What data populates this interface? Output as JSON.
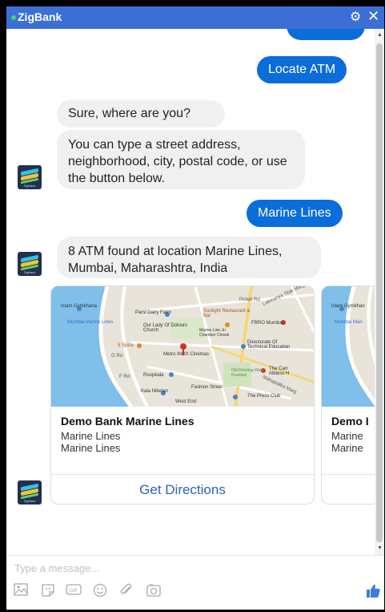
{
  "window": {
    "title": "ZigBank"
  },
  "messages": {
    "locate_atm": "Locate ATM",
    "where_are_you": "Sure, where are you?",
    "type_address": "You can type a street address, neighborhood, city, postal code, or use the button below.",
    "marine_lines": "Marine Lines",
    "atm_found": "8 ATM found at location Marine Lines, Mumbai, Maharashtra, India"
  },
  "avatar": {
    "label": "ZigBank"
  },
  "cards": [
    {
      "title": "Demo Bank Marine Lines",
      "line1": "Marine Lines",
      "line2": "Marine Lines",
      "button": "Get Directions"
    },
    {
      "title": "Demo I",
      "line1": "Marine",
      "line2": "Marine"
    }
  ],
  "map_labels": {
    "islam_gymkhana": "Islam Gymkhana",
    "parsi_dairy": "Parsi Dairy Farm",
    "sunlight": "Sunlight Restaurant & Bar",
    "picket_rd": "Picket Rd",
    "lokmanya": "Lokmanya Tilak Marg",
    "mumbai_marine_lines": "Mumbai Marine Lines",
    "our_lady": "Our Lady Of Dolours Church",
    "marine_line_chambers": "Marine Line Jn Chamber Chowk",
    "frro": "FRRO Mumbai",
    "five_spice": "5 Spice",
    "metro_inox": "Metro INOX Cinemas",
    "directorate": "Directorate Of Technical Education",
    "g_rd": "G Rd",
    "f_rd": "F Rd",
    "roopkala": "Roopkala",
    "old_drinking": "Old Drinking Water Fountain",
    "the_carr": "The Carr Albless H",
    "mahapalika": "Mahapalika Marg",
    "kala_niketan": "Kala Niketan",
    "fashion_street": "Fashion Street",
    "press_club": "The Press Club",
    "west_end": "West End",
    "islam_gymkhan2": "Islam Gymkhan",
    "mumbai_mari2": "Mumbai Mari"
  },
  "composer": {
    "placeholder": "Type a message..."
  },
  "icons": [
    "image-icon",
    "sticker-icon",
    "gif-icon",
    "emoji-icon",
    "attachment-icon",
    "camera-icon",
    "thumbs-up-icon",
    "gear-icon",
    "close-icon"
  ],
  "colors": {
    "titlebar": "#3b6fd6",
    "outgoing_bubble": "#0a6dd9",
    "incoming_bubble": "#f0f0f0",
    "link": "#2b64b3"
  }
}
